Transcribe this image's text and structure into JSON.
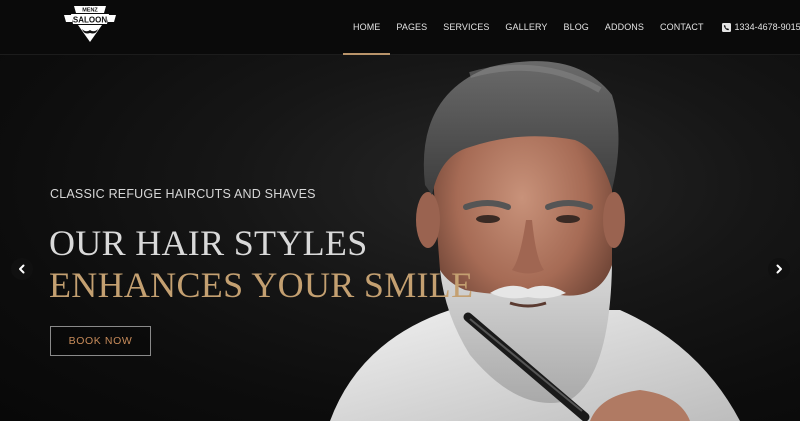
{
  "brand": {
    "logo_top": "MENZ",
    "logo_main": "SALOON"
  },
  "nav": {
    "items": [
      {
        "label": "HOME",
        "active": true
      },
      {
        "label": "PAGES"
      },
      {
        "label": "SERVICES"
      },
      {
        "label": "GALLERY"
      },
      {
        "label": "BLOG"
      },
      {
        "label": "ADDONS"
      },
      {
        "label": "CONTACT"
      }
    ],
    "phone": "1334-4678-9015",
    "phone_icon": "phone-icon"
  },
  "hero": {
    "subtitle": "CLASSIC REFUGE HAIRCUTS AND SHAVES",
    "headline_line1": "OUR HAIR STYLES",
    "headline_line2": "ENHANCES YOUR SMILE",
    "cta_label": "BOOK NOW",
    "prev_icon": "chevron-left-icon",
    "next_icon": "chevron-right-icon"
  },
  "colors": {
    "accent_gold": "#c4a071",
    "cta_text": "#c78b5a",
    "active_underline": "#b9946a",
    "background": "#0c0c0c"
  }
}
